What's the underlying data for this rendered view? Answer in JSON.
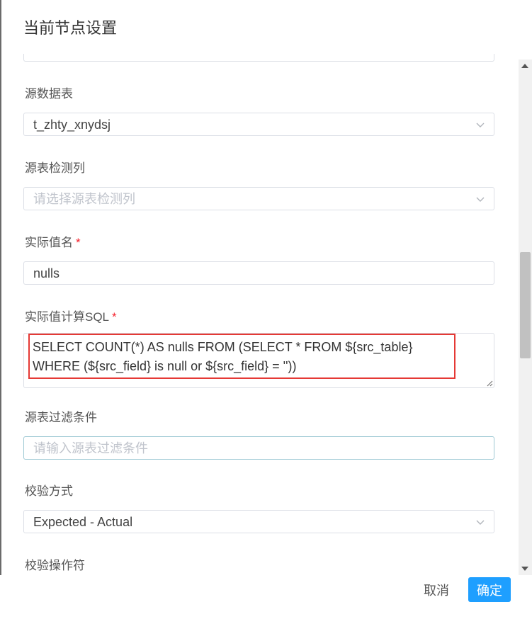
{
  "dialog": {
    "title": "当前节点设置"
  },
  "form": {
    "src_table": {
      "label": "源数据表",
      "value": "t_zhty_xnydsj"
    },
    "src_column": {
      "label": "源表检测列",
      "placeholder": "请选择源表检测列"
    },
    "actual_value_name": {
      "label": "实际值名",
      "required_mark": "*",
      "value": "nulls"
    },
    "actual_value_sql": {
      "label": "实际值计算SQL",
      "required_mark": "*",
      "value": "SELECT COUNT(*) AS nulls FROM (SELECT * FROM ${src_table} WHERE (${src_field} is null or ${src_field} = ''))"
    },
    "src_filter": {
      "label": "源表过滤条件",
      "placeholder": "请输入源表过滤条件"
    },
    "check_method": {
      "label": "校验方式",
      "value": "Expected - Actual"
    },
    "check_operator": {
      "label": "校验操作符"
    }
  },
  "footer": {
    "cancel_label": "取消",
    "ok_label": "确定"
  },
  "colors": {
    "primary": "#1e9fff",
    "required": "#f5222d",
    "highlight": "#e53935"
  },
  "icons": {
    "select_arrow": "chevron-down-icon",
    "resize": "resize-handle-icon"
  }
}
